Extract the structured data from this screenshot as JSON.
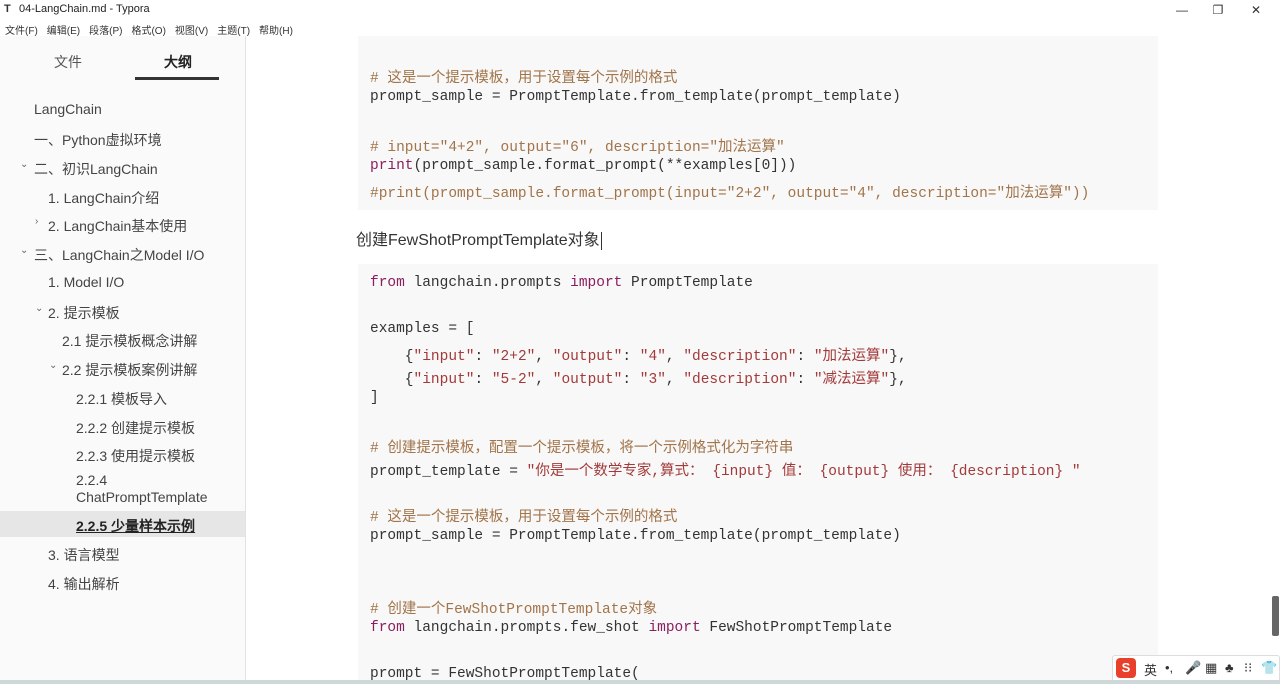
{
  "window": {
    "title": "04-LangChain.md - Typora",
    "app_icon": "T",
    "controls": {
      "minimize": "—",
      "maximize": "❐",
      "close": "✕"
    }
  },
  "menu": [
    "文件(F)",
    "编辑(E)",
    "段落(P)",
    "格式(O)",
    "视图(V)",
    "主题(T)",
    "帮助(H)"
  ],
  "sidebar": {
    "tabs": {
      "files": "文件",
      "outline": "大纲"
    },
    "items": [
      {
        "label": "LangChain",
        "chevron": ""
      },
      {
        "label": "一、Python虚拟环境",
        "chevron": ""
      },
      {
        "label": "二、初识LangChain",
        "chevron": "⌄"
      },
      {
        "label": "1. LangChain介绍",
        "chevron": ""
      },
      {
        "label": "2. LangChain基本使用",
        "chevron": "›"
      },
      {
        "label": "三、LangChain之Model I/O",
        "chevron": "⌄"
      },
      {
        "label": "1. Model I/O",
        "chevron": ""
      },
      {
        "label": "2. 提示模板",
        "chevron": "⌄"
      },
      {
        "label": "2.1 提示模板概念讲解",
        "chevron": ""
      },
      {
        "label": "2.2 提示模板案例讲解",
        "chevron": "⌄"
      },
      {
        "label": "2.2.1 模板导入",
        "chevron": ""
      },
      {
        "label": "2.2.2 创建提示模板",
        "chevron": ""
      },
      {
        "label": "2.2.3 使用提示模板",
        "chevron": ""
      },
      {
        "label_line1": "2.2.4",
        "label_line2": "ChatPromptTemplate",
        "chevron": ""
      },
      {
        "label": "2.2.5 少量样本示例",
        "chevron": ""
      },
      {
        "label": "3. 语言模型",
        "chevron": ""
      },
      {
        "label": "4. 输出解析",
        "chevron": ""
      }
    ],
    "footer": {
      "back": "‹",
      "source": "</>"
    }
  },
  "editor": {
    "block1": {
      "comment1": "# 这是一个提示模板，用于设置每个示例的格式",
      "line2": "prompt_sample = PromptTemplate.from_template(prompt_template)",
      "comment3": "# input=\"4+2\", output=\"6\", description=\"加法运算\"",
      "line4_kw": "print",
      "line4_rest": "(prompt_sample.format_prompt(**examples[0]))",
      "comment5": "#print(prompt_sample.format_prompt(input=\"2+2\", output=\"4\", description=\"加法运算\"))"
    },
    "paragraph": "创建FewShotPromptTemplate对象",
    "block2": {
      "l1_kw1": "from",
      "l1_mid": " langchain.prompts ",
      "l1_kw2": "import",
      "l1_end": " PromptTemplate",
      "l2": "examples = [",
      "l3_a": "    {",
      "l3_b": "\"input\"",
      "l3_c": ": ",
      "l3_d": "\"2+2\"",
      "l3_e": ", ",
      "l3_f": "\"output\"",
      "l3_g": ": ",
      "l3_h": "\"4\"",
      "l3_i": ", ",
      "l3_j": "\"description\"",
      "l3_k": ": ",
      "l3_l": "\"加法运算\"",
      "l3_m": "},",
      "l4_b": "\"input\"",
      "l4_d": "\"5-2\"",
      "l4_f": "\"output\"",
      "l4_h": "\"3\"",
      "l4_j": "\"description\"",
      "l4_l": "\"减法运算\"",
      "l5": "]",
      "c6": "# 创建提示模板，配置一个提示模板，将一个示例格式化为字符串",
      "l7_a": "prompt_template = ",
      "l7_b": "\"你是一个数学专家,算式： {input} 值： {output} 使用： {description} \"",
      "c8": "# 这是一个提示模板，用于设置每个示例的格式",
      "l9": "prompt_sample = PromptTemplate.from_template(prompt_template)",
      "c10": "# 创建一个FewShotPromptTemplate对象",
      "l11_kw1": "from",
      "l11_mid": " langchain.prompts.few_shot ",
      "l11_kw2": "import",
      "l11_end": " FewShotPromptTemplate",
      "l12": "prompt = FewShotPromptTemplate("
    }
  },
  "ime": {
    "logo": "S",
    "lang": "英",
    "punct": "•,",
    "mic": "🎤",
    "kbd": "▦",
    "skin": "♣",
    "grid": "⁝⁝",
    "shirt": "👕"
  }
}
